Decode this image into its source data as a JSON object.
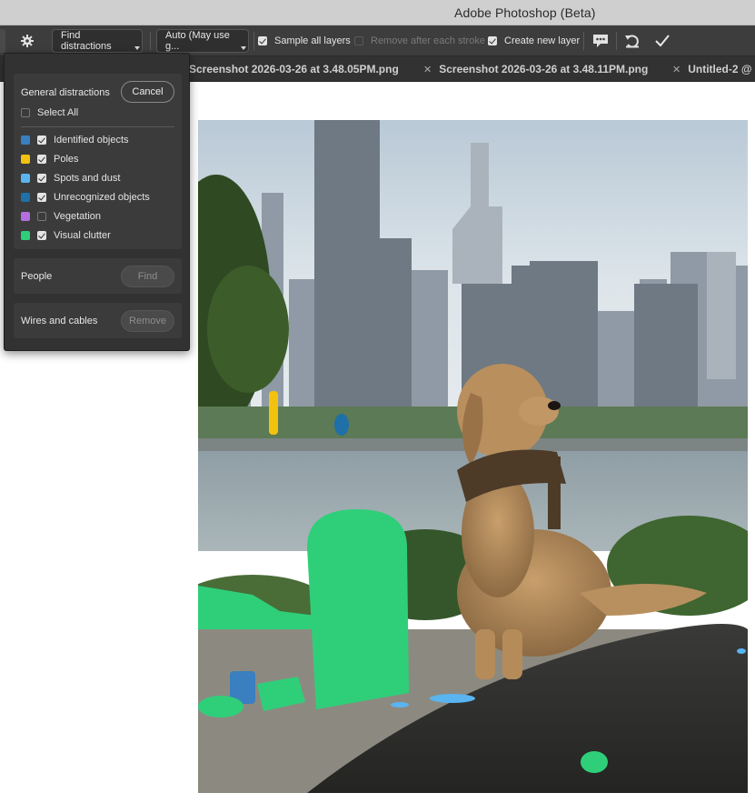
{
  "window": {
    "title": "Adobe Photoshop (Beta)"
  },
  "options_bar": {
    "find_distractions": "Find distractions",
    "mode": "Auto (May use g...",
    "sample_all_layers": {
      "label": "Sample all layers",
      "checked": true
    },
    "remove_after_stroke": {
      "label": "Remove after each stroke",
      "checked": false,
      "enabled": false
    },
    "create_new_layer": {
      "label": "Create new layer",
      "checked": true
    }
  },
  "tabs": [
    {
      "label": "Screenshot 2026-03-26 at 3.48.05PM.png"
    },
    {
      "label": "Screenshot 2026-03-26 at 3.48.11PM.png"
    },
    {
      "label": "Untitled-2 @"
    }
  ],
  "distractions_panel": {
    "general": {
      "title": "General distractions",
      "cancel": "Cancel",
      "select_all": {
        "label": "Select All",
        "checked": false
      },
      "items": [
        {
          "label": "Identified objects",
          "color": "#3a7fbf",
          "checked": true
        },
        {
          "label": "Poles",
          "color": "#f2c20f",
          "checked": true
        },
        {
          "label": "Spots and dust",
          "color": "#5ab4f0",
          "checked": true
        },
        {
          "label": "Unrecognized objects",
          "color": "#1f6fa8",
          "checked": true
        },
        {
          "label": "Vegetation",
          "color": "#b36fe0",
          "checked": false
        },
        {
          "label": "Visual clutter",
          "color": "#2fcf7a",
          "checked": true
        }
      ]
    },
    "people": {
      "title": "People",
      "button": "Find"
    },
    "wires": {
      "title": "Wires and cables",
      "button": "Remove"
    }
  }
}
